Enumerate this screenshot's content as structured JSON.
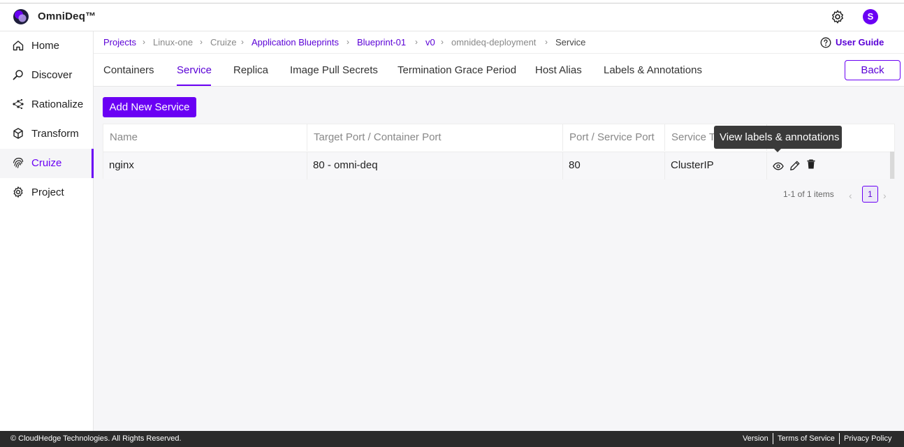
{
  "app": {
    "name": "OmniDeq™",
    "avatar_initial": "S",
    "accent": "#6a00f4"
  },
  "sidebar": {
    "items": [
      {
        "label": "Home",
        "icon": "home-icon"
      },
      {
        "label": "Discover",
        "icon": "search-icon"
      },
      {
        "label": "Rationalize",
        "icon": "network-icon"
      },
      {
        "label": "Transform",
        "icon": "cube-icon"
      },
      {
        "label": "Cruize",
        "icon": "fingerprint-icon",
        "active": true
      },
      {
        "label": "Project",
        "icon": "gear-icon"
      }
    ]
  },
  "breadcrumb": [
    "Projects",
    "Linux-one",
    "Cruize",
    "Application Blueprints",
    "Blueprint-01",
    "v0",
    "omnideq-deployment",
    "Service"
  ],
  "user_guide": "User Guide",
  "tabs": [
    "Containers",
    "Service",
    "Replica",
    "Image Pull Secrets",
    "Termination Grace Period",
    "Host Alias",
    "Labels & Annotations"
  ],
  "active_tab": "Service",
  "back_label": "Back",
  "add_label": "Add New Service",
  "table": {
    "columns": [
      "Name",
      "Target Port / Container Port",
      "Port / Service Port",
      "Service Type",
      ""
    ],
    "rows": [
      {
        "name": "nginx",
        "target_port": "80 - omni-deq",
        "service_port": "80",
        "service_type": "ClusterIP"
      }
    ]
  },
  "tooltip": "View labels & annotations",
  "pagination": {
    "info": "1-1 of 1 items",
    "current": "1"
  },
  "footer": {
    "copyright": "© CloudHedge Technologies. All Rights Reserved.",
    "links": [
      "Version",
      "Terms of Service",
      "Privacy Policy"
    ]
  }
}
